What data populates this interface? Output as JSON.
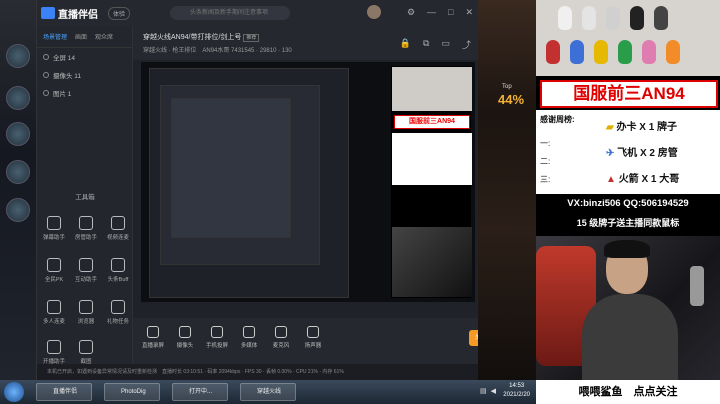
{
  "app": {
    "name": "直播伴侣",
    "user_chip": "体验",
    "search_placeholder": "头条新闻及新手期间注意事项",
    "window_controls": [
      "—",
      "□",
      "✕"
    ]
  },
  "left_panel": {
    "tabs": [
      "场景管理",
      "画面",
      "观众席"
    ],
    "scenes": [
      {
        "label": "全屏 14"
      },
      {
        "label": "摄像头 11"
      },
      {
        "label": "图片 1"
      }
    ],
    "tools_title": "工具箱",
    "tools": [
      "弹幕助手",
      "房管助手",
      "视频连麦",
      "全民PK",
      "互动助手",
      "头条Buff",
      "多人连麦",
      "浏览器",
      "礼物任务",
      "开播助手",
      "截图"
    ]
  },
  "mid": {
    "title": "穿越火线AN94/带打排位/剑上号",
    "title_tag": "推荐",
    "subtitle": "穿越火线 · 枪王排位",
    "room": "AN94水哥 7431545 · 29810 · 130"
  },
  "bottom": {
    "buttons": [
      "直播录屏",
      "摄像头",
      "手机投屏",
      "多媒体",
      "麦克风",
      "扬声器"
    ],
    "go_live": "关闭直播"
  },
  "status": {
    "text": "直播时长 03:10:51 · 码率 2094kbps · FPS 30 · 丢帧 0.00% · CPU 21% · 内存 61%"
  },
  "notice": "本机已开启，如遇到设备异常情况请及时重新检测",
  "game": {
    "percent": "44%",
    "top_label": "Top"
  },
  "overlay": {
    "title": "国服前三AN94",
    "thanks_label": "感谢周榜:",
    "thanks_names": [
      "一:",
      "二:",
      "三:"
    ],
    "rewards": [
      "办卡 X 1 牌子",
      "飞机 X 2 房管",
      "火箭 X 1 大哥"
    ],
    "vx": "VX:binzi506  QQ:506194529",
    "badge": "15 级牌子送主播同款鼠标",
    "caption": "喂喂鲨鱼　点点关注"
  },
  "taskbar": {
    "tasks": [
      "直播伴侣",
      "PhotoDig",
      "打开中...",
      "穿越火线"
    ],
    "time": "14:53",
    "date": "2021/2/20"
  },
  "colors": {
    "accent": "#f59a23",
    "overlay_red": "#e00000",
    "link": "#4aa3ff"
  }
}
